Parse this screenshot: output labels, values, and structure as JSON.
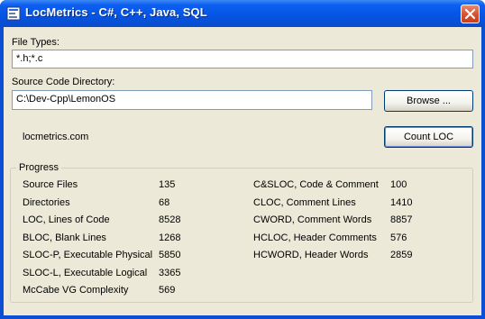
{
  "window": {
    "title": "LocMetrics - C#, C++, Java, SQL"
  },
  "form": {
    "file_types_label": "File Types:",
    "file_types_value": "*.h;*.c",
    "source_dir_label": "Source Code Directory:",
    "source_dir_value": "C:\\Dev-Cpp\\LemonOS",
    "browse_label": "Browse ...",
    "link_text": "locmetrics.com",
    "count_label": "Count LOC"
  },
  "progress": {
    "title": "Progress",
    "left": [
      {
        "label": "Source Files",
        "value": "135"
      },
      {
        "label": "Directories",
        "value": "68"
      },
      {
        "label": "LOC, Lines of Code",
        "value": "8528"
      },
      {
        "label": "BLOC, Blank Lines",
        "value": "1268"
      },
      {
        "label": "SLOC-P, Executable Physical",
        "value": "5850"
      },
      {
        "label": "SLOC-L, Executable Logical",
        "value": "3365"
      },
      {
        "label": "McCabe VG Complexity",
        "value": "569"
      }
    ],
    "right": [
      {
        "label": "C&SLOC, Code & Comment",
        "value": "100"
      },
      {
        "label": "CLOC, Comment Lines",
        "value": "1410"
      },
      {
        "label": "CWORD, Comment Words",
        "value": "8857"
      },
      {
        "label": "HCLOC, Header Comments",
        "value": "576"
      },
      {
        "label": "HCWORD, Header Words",
        "value": "2859"
      }
    ]
  },
  "colors": {
    "titlebar": "#0554e3",
    "client_bg": "#ece9d8",
    "close_button": "#d4512b"
  }
}
